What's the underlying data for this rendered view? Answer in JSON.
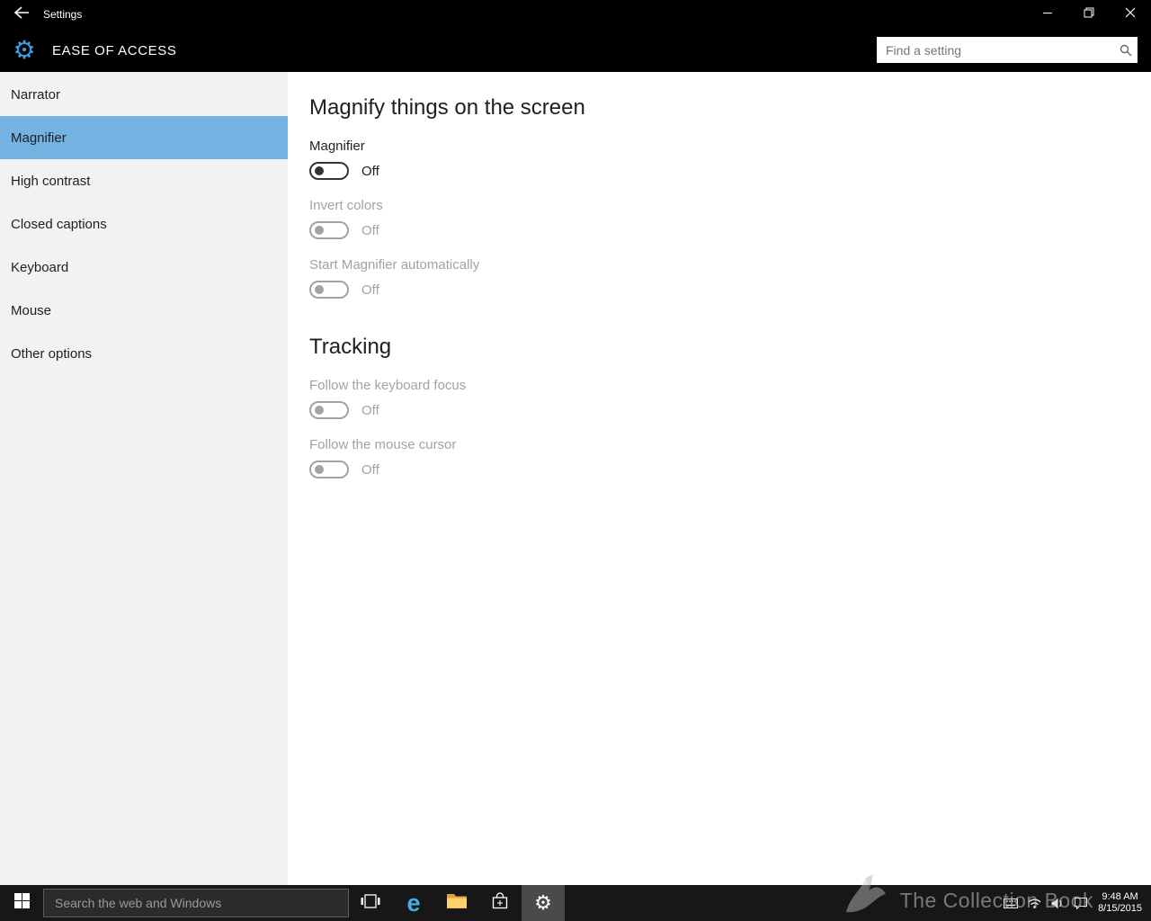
{
  "window": {
    "title": "Settings"
  },
  "header": {
    "title": "EASE OF ACCESS",
    "search_placeholder": "Find a setting"
  },
  "sidebar": {
    "items": [
      {
        "label": "Narrator",
        "selected": false
      },
      {
        "label": "Magnifier",
        "selected": true
      },
      {
        "label": "High contrast",
        "selected": false
      },
      {
        "label": "Closed captions",
        "selected": false
      },
      {
        "label": "Keyboard",
        "selected": false
      },
      {
        "label": "Mouse",
        "selected": false
      },
      {
        "label": "Other options",
        "selected": false
      }
    ]
  },
  "main": {
    "sections": [
      {
        "heading": "Magnify things on the screen",
        "toggles": [
          {
            "label": "Magnifier",
            "state": "Off",
            "enabled": true
          },
          {
            "label": "Invert colors",
            "state": "Off",
            "enabled": false
          },
          {
            "label": "Start Magnifier automatically",
            "state": "Off",
            "enabled": false
          }
        ]
      },
      {
        "heading": "Tracking",
        "toggles": [
          {
            "label": "Follow the keyboard focus",
            "state": "Off",
            "enabled": false
          },
          {
            "label": "Follow the mouse cursor",
            "state": "Off",
            "enabled": false
          }
        ]
      }
    ]
  },
  "taskbar": {
    "search_placeholder": "Search the web and Windows",
    "clock": {
      "time": "9:48 AM",
      "date": "8/15/2015"
    }
  },
  "watermark": {
    "text": "The Collection Book"
  },
  "icons": {
    "settings_gear": "⚙",
    "edge": "e"
  },
  "colors": {
    "titlebar": "#000000",
    "sidebar_bg": "#f2f2f2",
    "sidebar_selected": "#74b2e2",
    "gear_blue": "#3aa0e8",
    "taskbar_bg": "#171717",
    "taskbar_active_button": "#4a4a4a",
    "edge_blue": "#41b0e6",
    "folder_yellow": "#ffd36b",
    "toggle_enabled": "#333333",
    "toggle_disabled": "#a3a3a3"
  }
}
